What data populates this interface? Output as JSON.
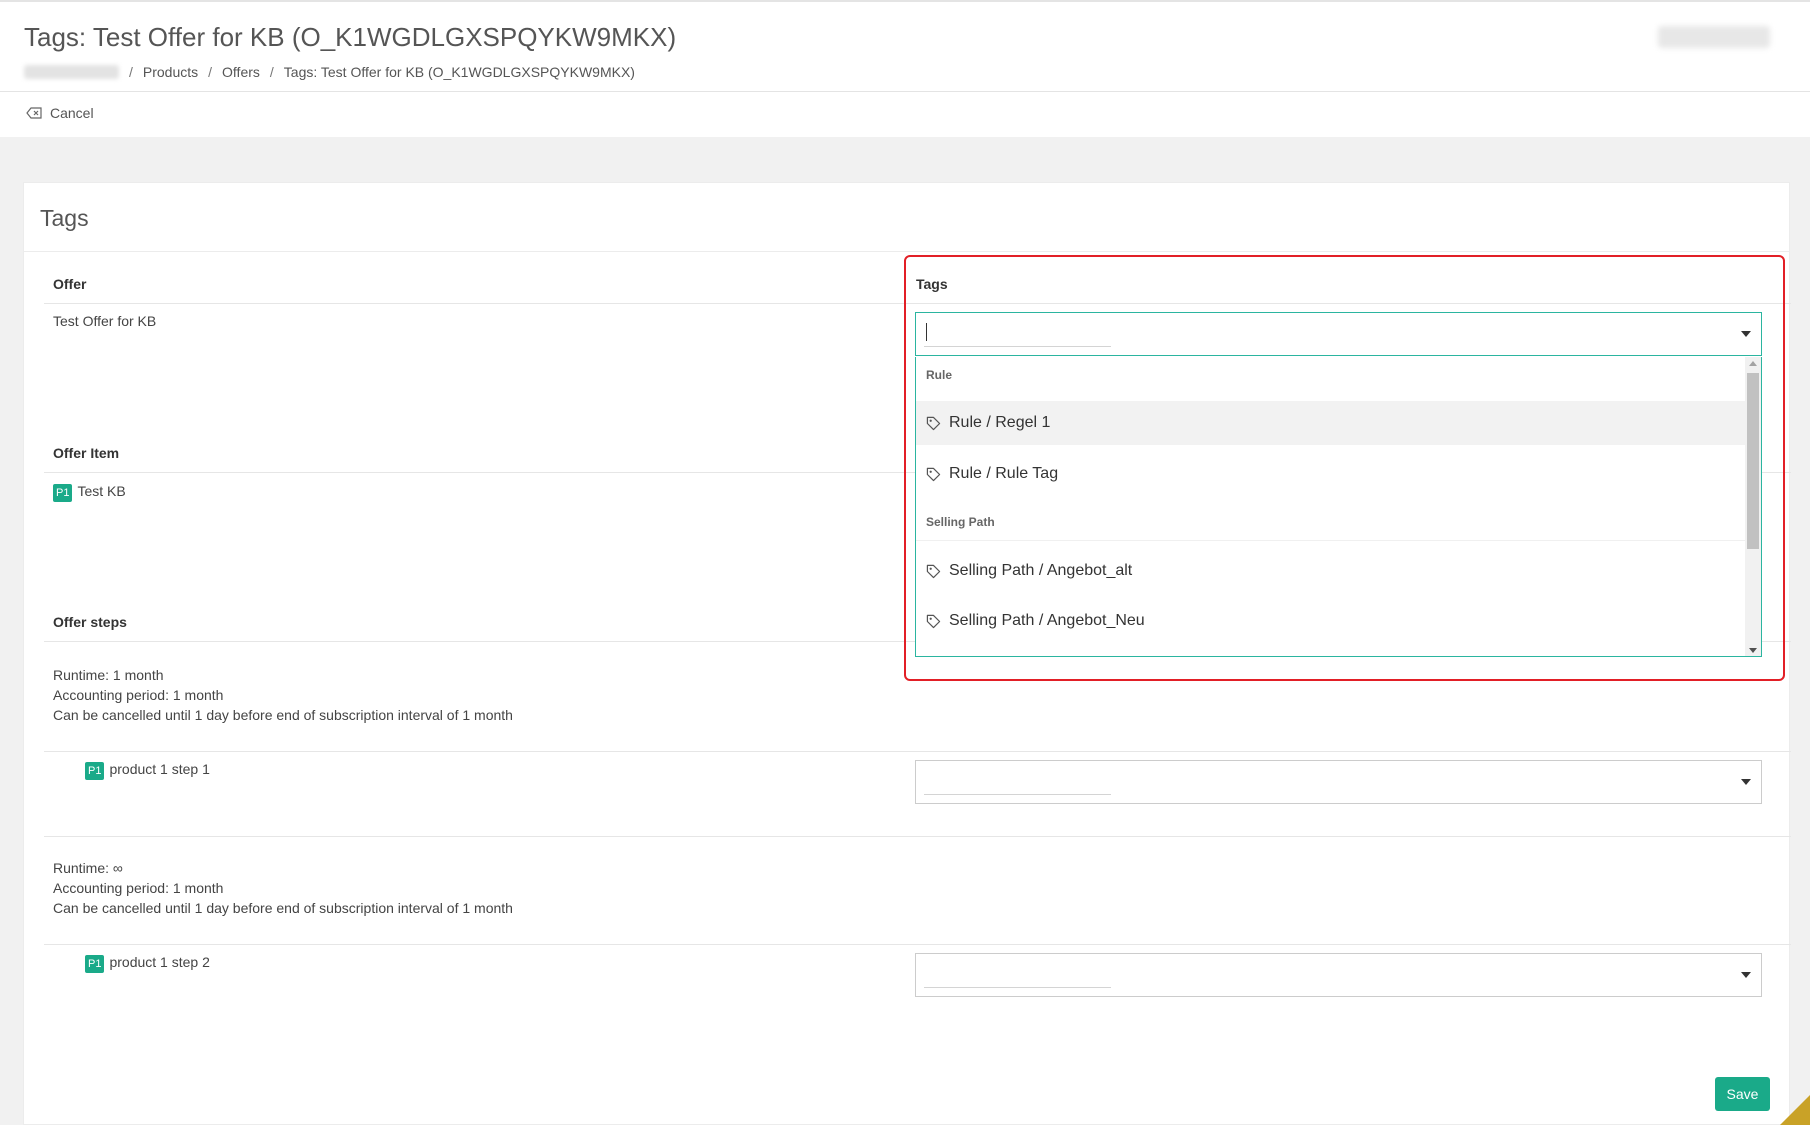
{
  "header": {
    "title": "Tags: Test Offer for KB (O_K1WGDLGXSPQYKW9MKX)",
    "breadcrumb": [
      "Products",
      "Offers",
      "Tags: Test Offer for KB (O_K1WGDLGXSPQYKW9MKX)"
    ]
  },
  "actions": {
    "cancel_label": "Cancel",
    "save_label": "Save"
  },
  "card": {
    "title": "Tags",
    "offer_header": "Offer",
    "tags_header": "Tags",
    "offer_name": "Test Offer for KB",
    "offer_item_header": "Offer Item",
    "offer_item": {
      "badge": "P1",
      "name": "Test KB"
    },
    "offer_steps_header": "Offer steps",
    "steps": [
      {
        "runtime": "Runtime:  1 month",
        "accounting": "Accounting period:  1 month",
        "cancel": "Can be cancelled until 1 day before end of subscription interval of 1 month",
        "badge": "P1",
        "product": "product 1 step 1"
      },
      {
        "runtime": "Runtime: ∞",
        "accounting": "Accounting period:  1 month",
        "cancel": "Can be cancelled until 1 day before end of subscription interval of 1 month",
        "badge": "P1",
        "product": "product 1 step 2"
      }
    ]
  },
  "dropdown": {
    "groups": [
      {
        "label": "Rule",
        "options": [
          "Rule / Regel 1",
          "Rule / Rule Tag"
        ]
      },
      {
        "label": "Selling Path",
        "options": [
          "Selling Path / Angebot_alt",
          "Selling Path / Angebot_Neu"
        ]
      }
    ],
    "highlighted_option": "Rule / Regel 1"
  },
  "colors": {
    "accent": "#1aaa89",
    "focus_border": "#2bb5a0",
    "annotation": "#e21f26"
  },
  "icons": {
    "cancel": "backspace-icon",
    "tag": "tag-icon",
    "caret": "caret-down-icon"
  }
}
